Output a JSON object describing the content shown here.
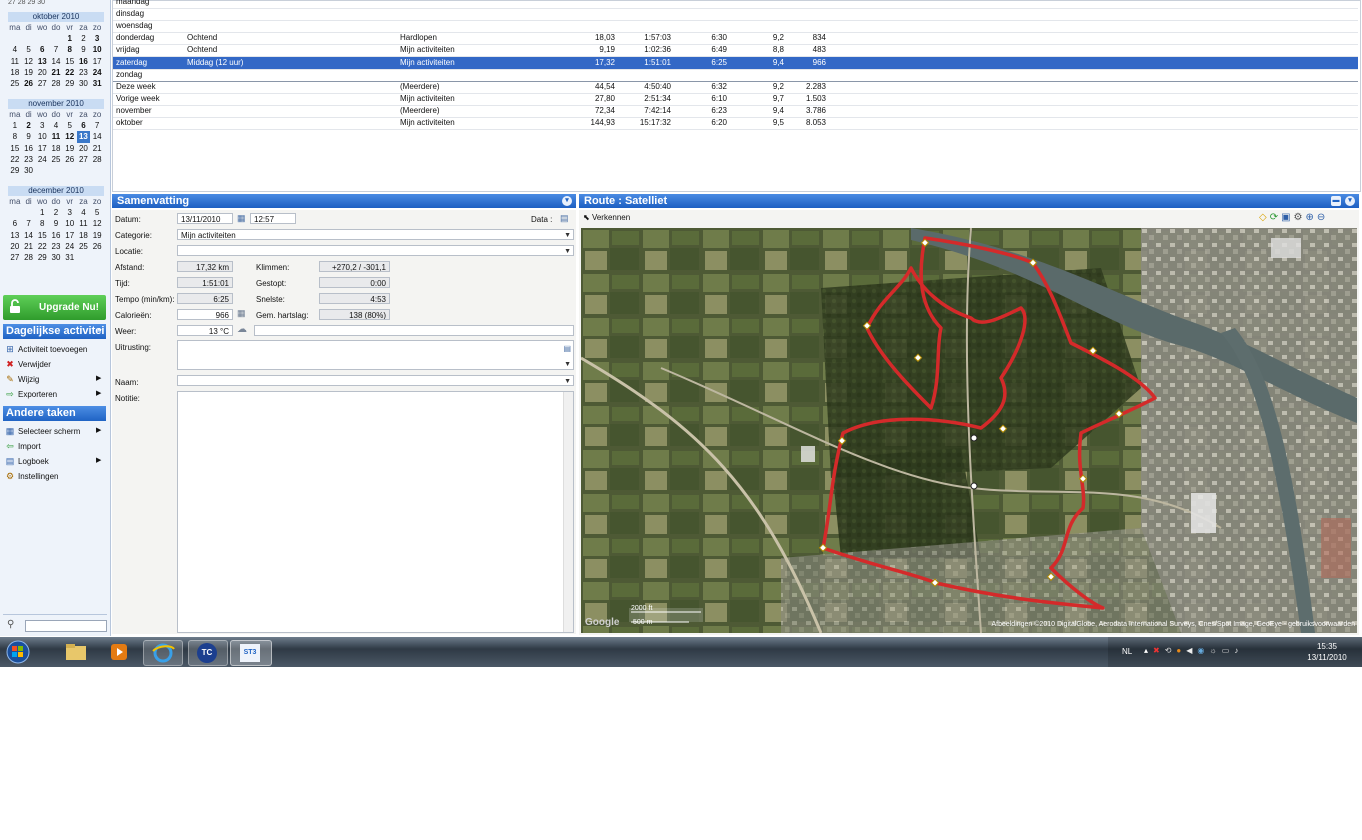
{
  "calendars": [
    {
      "title": "oktober 2010",
      "days": [
        "ma",
        "di",
        "wo",
        "do",
        "vr",
        "za",
        "zo"
      ],
      "cells": [
        [
          "",
          "",
          ""
        ],
        [
          "",
          "",
          ""
        ],
        [
          "",
          "",
          ""
        ],
        [
          "",
          "",
          ""
        ],
        [
          "1",
          "b"
        ],
        [
          "2",
          ""
        ],
        [
          "3",
          "b"
        ],
        [
          "4",
          ""
        ],
        [
          "5",
          ""
        ],
        [
          "6",
          "b"
        ],
        [
          "7",
          ""
        ],
        [
          "8",
          "b"
        ],
        [
          "9",
          ""
        ],
        [
          "10",
          "b"
        ],
        [
          "11",
          ""
        ],
        [
          "12",
          ""
        ],
        [
          "13",
          "b"
        ],
        [
          "14",
          ""
        ],
        [
          "15",
          ""
        ],
        [
          "16",
          "b"
        ],
        [
          "17",
          ""
        ],
        [
          "18",
          ""
        ],
        [
          "19",
          ""
        ],
        [
          "20",
          ""
        ],
        [
          "21",
          "b"
        ],
        [
          "22",
          "b"
        ],
        [
          "23",
          ""
        ],
        [
          "24",
          "b"
        ],
        [
          "25",
          ""
        ],
        [
          "26",
          "b"
        ],
        [
          "27",
          ""
        ],
        [
          "28",
          ""
        ],
        [
          "29",
          ""
        ],
        [
          "30",
          ""
        ],
        [
          "31",
          "b"
        ]
      ]
    },
    {
      "title": "november 2010",
      "days": [
        "ma",
        "di",
        "wo",
        "do",
        "vr",
        "za",
        "zo"
      ],
      "cells": [
        [
          "1",
          ""
        ],
        [
          "2",
          "b"
        ],
        [
          "3",
          ""
        ],
        [
          "4",
          ""
        ],
        [
          "5",
          ""
        ],
        [
          "6",
          "b"
        ],
        [
          "7",
          ""
        ],
        [
          "8",
          ""
        ],
        [
          "9",
          ""
        ],
        [
          "10",
          ""
        ],
        [
          "11",
          "b"
        ],
        [
          "12",
          "b"
        ],
        [
          "13",
          "sel"
        ],
        [
          "14",
          ""
        ],
        [
          "15",
          ""
        ],
        [
          "16",
          ""
        ],
        [
          "17",
          ""
        ],
        [
          "18",
          ""
        ],
        [
          "19",
          ""
        ],
        [
          "20",
          ""
        ],
        [
          "21",
          ""
        ],
        [
          "22",
          ""
        ],
        [
          "23",
          ""
        ],
        [
          "24",
          ""
        ],
        [
          "25",
          ""
        ],
        [
          "26",
          ""
        ],
        [
          "27",
          ""
        ],
        [
          "28",
          ""
        ],
        [
          "29",
          ""
        ],
        [
          "30",
          ""
        ]
      ]
    },
    {
      "title": "december 2010",
      "days": [
        "ma",
        "di",
        "wo",
        "do",
        "vr",
        "za",
        "zo"
      ],
      "cells": [
        [
          "",
          ""
        ],
        [
          "",
          ""
        ],
        [
          "1",
          ""
        ],
        [
          "2",
          ""
        ],
        [
          "3",
          ""
        ],
        [
          "4",
          ""
        ],
        [
          "5",
          ""
        ],
        [
          "6",
          ""
        ],
        [
          "7",
          ""
        ],
        [
          "8",
          ""
        ],
        [
          "9",
          ""
        ],
        [
          "10",
          ""
        ],
        [
          "11",
          ""
        ],
        [
          "12",
          ""
        ],
        [
          "13",
          ""
        ],
        [
          "14",
          ""
        ],
        [
          "15",
          ""
        ],
        [
          "16",
          ""
        ],
        [
          "17",
          ""
        ],
        [
          "18",
          ""
        ],
        [
          "19",
          ""
        ],
        [
          "20",
          ""
        ],
        [
          "21",
          ""
        ],
        [
          "22",
          ""
        ],
        [
          "23",
          ""
        ],
        [
          "24",
          ""
        ],
        [
          "25",
          ""
        ],
        [
          "26",
          ""
        ],
        [
          "27",
          ""
        ],
        [
          "28",
          ""
        ],
        [
          "29",
          ""
        ],
        [
          "30",
          ""
        ],
        [
          "31",
          ""
        ]
      ]
    }
  ],
  "upgrade_label": "Upgrade Nu!",
  "daily": {
    "title": "Dagelijkse activitei",
    "items": [
      {
        "label": "Activiteit toevoegen",
        "icon": "add-activity-icon"
      },
      {
        "label": "Verwijder",
        "icon": "delete-icon"
      },
      {
        "label": "Wijzig",
        "icon": "edit-icon",
        "submenu": true
      },
      {
        "label": "Exporteren",
        "icon": "export-icon",
        "submenu": true
      }
    ]
  },
  "other": {
    "title": "Andere taken",
    "items": [
      {
        "label": "Selecteer scherm",
        "icon": "select-screen-icon",
        "submenu": true
      },
      {
        "label": "Import",
        "icon": "import-icon"
      },
      {
        "label": "Logboek",
        "icon": "logbook-icon",
        "submenu": true
      },
      {
        "label": "Instellingen",
        "icon": "settings-icon"
      }
    ]
  },
  "grid_rows": [
    {
      "day": "maandag"
    },
    {
      "day": "dinsdag"
    },
    {
      "day": "woensdag"
    },
    {
      "day": "donderdag",
      "time": "Ochtend",
      "cat": "Hardlopen",
      "dist": "18,03",
      "dur": "1:57:03",
      "pace": "6:30",
      "speed": "9,2",
      "cal": "834"
    },
    {
      "day": "vrijdag",
      "time": "Ochtend",
      "cat": "Mijn activiteiten",
      "dist": "9,19",
      "dur": "1:02:36",
      "pace": "6:49",
      "speed": "8,8",
      "cal": "483"
    },
    {
      "day": "zaterdag",
      "time": "Middag (12 uur)",
      "cat": "Mijn activiteiten",
      "dist": "17,32",
      "dur": "1:51:01",
      "pace": "6:25",
      "speed": "9,4",
      "cal": "966",
      "selected": true
    },
    {
      "day": "zondag",
      "sep": true
    },
    {
      "day": "Deze week",
      "cat": "(Meerdere)",
      "dist": "44,54",
      "dur": "4:50:40",
      "pace": "6:32",
      "speed": "9,2",
      "cal": "2.283"
    },
    {
      "day": "Vorige week",
      "cat": "Mijn activiteiten",
      "dist": "27,80",
      "dur": "2:51:34",
      "pace": "6:10",
      "speed": "9,7",
      "cal": "1.503"
    },
    {
      "day": "november",
      "cat": "(Meerdere)",
      "dist": "72,34",
      "dur": "7:42:14",
      "pace": "6:23",
      "speed": "9,4",
      "cal": "3.786"
    },
    {
      "day": "oktober",
      "cat": "Mijn activiteiten",
      "dist": "144,93",
      "dur": "15:17:32",
      "pace": "6:20",
      "speed": "9,5",
      "cal": "8.053"
    }
  ],
  "summary": {
    "title": "Samenvatting",
    "datum_label": "Datum:",
    "datum": "13/11/2010",
    "tijdstip": "12:57",
    "data_label": "Data :",
    "categorie_label": "Categorie:",
    "categorie": "Mijn activiteiten",
    "locatie_label": "Locatie:",
    "locatie": "",
    "afstand_label": "Afstand:",
    "afstand": "17,32 km",
    "klimmen_label": "Klimmen:",
    "klimmen": "+270,2 / -301,1",
    "tijd_label": "Tijd:",
    "tijd": "1:51:01",
    "gestopt_label": "Gestopt:",
    "gestopt": "0:00",
    "tempo_label": "Tempo (min/km):",
    "tempo": "6:25",
    "snelste_label": "Snelste:",
    "snelste": "4:53",
    "calorieen_label": "Calorieën:",
    "calorieen": "966",
    "hartslag_label": "Gem. hartslag:",
    "hartslag": "138 (80%)",
    "weer_label": "Weer:",
    "weer": "13 °C",
    "uitrusting_label": "Uitrusting:",
    "naam_label": "Naam:",
    "naam": "",
    "notitie_label": "Notitie:"
  },
  "route": {
    "title": "Route : Satelliet",
    "explore_label": "Verkennen",
    "scale_ft": "2000 ft",
    "scale_m": "500 m",
    "attribution": "Afbeeldingen ©2010 DigitalGlobe, Aerodata International Surveys, Cnes/Spot Image, GeoEye - gebruiksvoorwaarden",
    "route_color": "#d42a2a"
  },
  "taskbar": {
    "lang": "NL",
    "time": "15:35",
    "date": "13/11/2010",
    "apps": [
      "TC",
      "ST3"
    ]
  },
  "colors": {
    "accent": "#1f63c4",
    "selection": "#3368c6",
    "upgrade": "#3cb043"
  }
}
